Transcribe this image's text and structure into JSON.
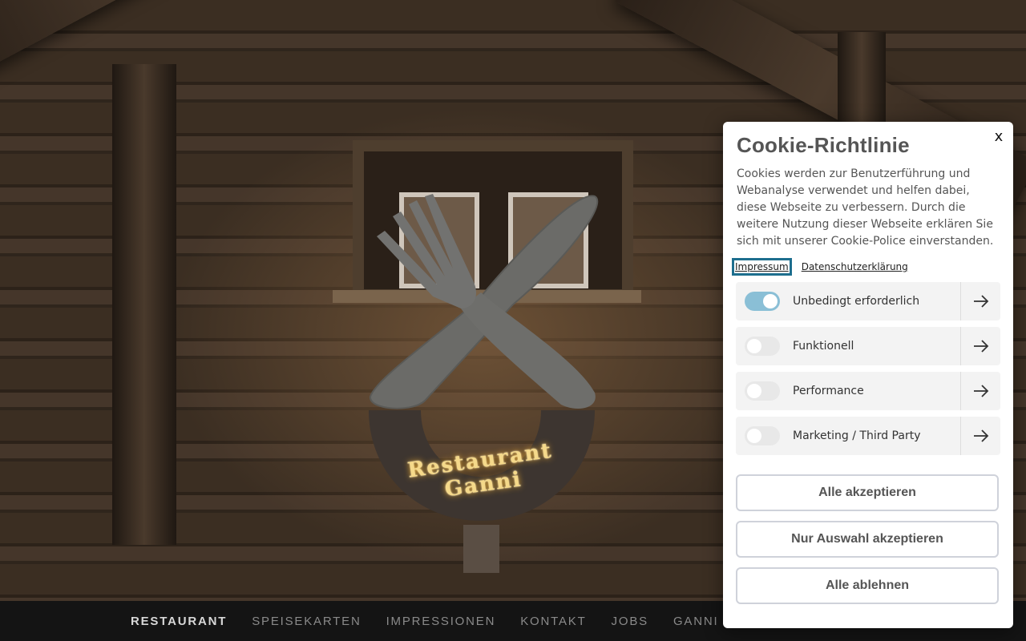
{
  "nav": {
    "items": [
      "RESTAURANT",
      "SPEISEKARTEN",
      "IMPRESSIONEN",
      "KONTAKT",
      "JOBS",
      "GANNI F"
    ]
  },
  "sign": {
    "lettering": "Restaurant Ganni"
  },
  "cookie": {
    "title": "Cookie-Richtlinie",
    "close_label": "x",
    "text": "Cookies werden zur Benutzerführung und Webanalyse verwendet und helfen dabei, diese Webseite zu verbessern. Durch die weitere Nutzung dieser Webseite erklären Sie sich mit unserer Cookie-Police einverstanden.",
    "links": {
      "impressum": "Impressum",
      "datenschutz": "Datenschutzerklärung"
    },
    "categories": [
      {
        "label": "Unbedingt erforderlich",
        "enabled": true
      },
      {
        "label": "Funktionell",
        "enabled": false
      },
      {
        "label": "Performance",
        "enabled": false
      },
      {
        "label": "Marketing / Third Party",
        "enabled": false
      }
    ],
    "buttons": {
      "accept_all": "Alle akzeptieren",
      "accept_selection": "Nur Auswahl akzeptieren",
      "reject_all": "Alle ablehnen"
    }
  },
  "colors": {
    "toggle_on": "#8abfd6",
    "focus_ring": "#1d6e8e",
    "nav_bg": "#141414"
  }
}
